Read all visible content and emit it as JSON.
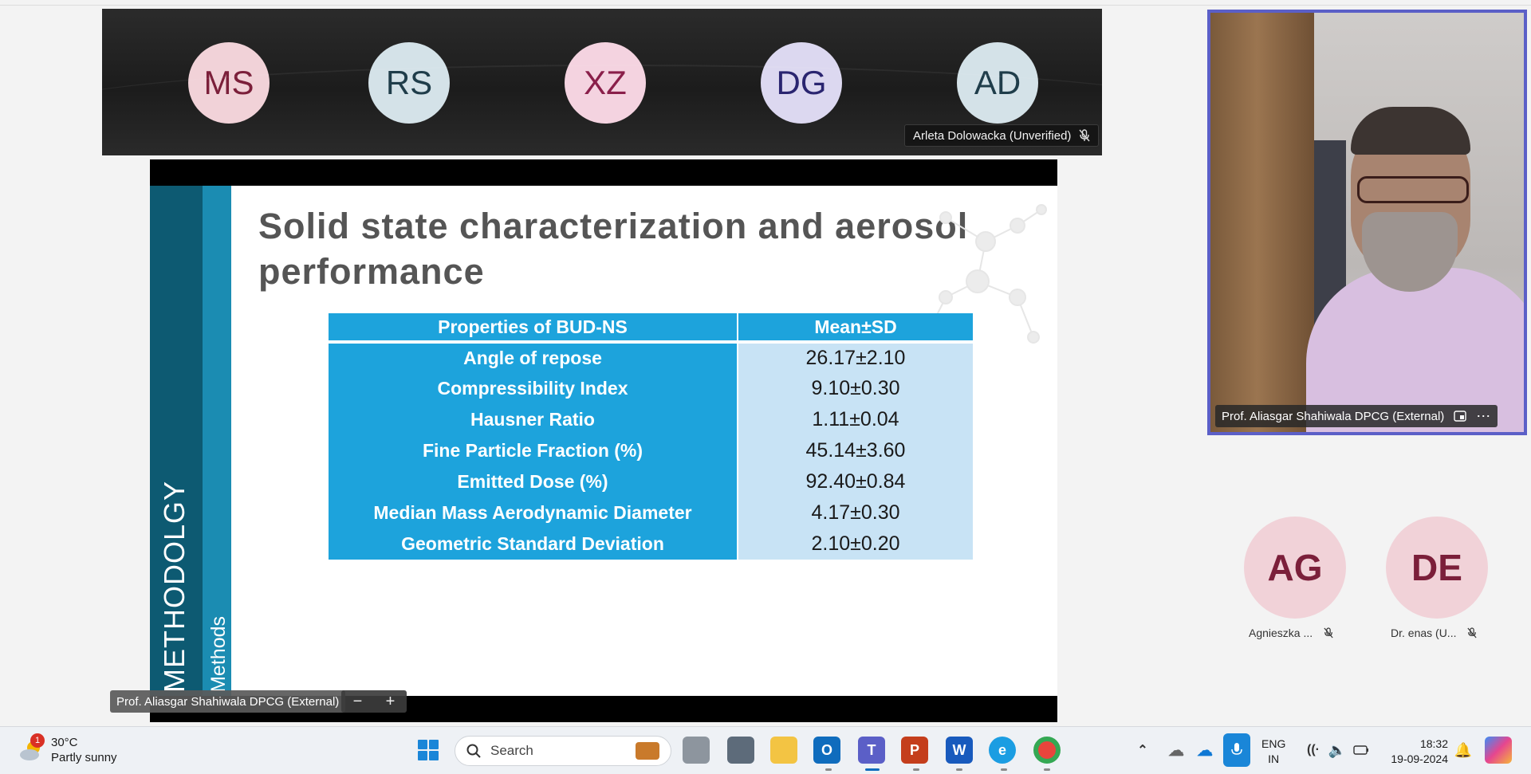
{
  "strip": {
    "participants": [
      {
        "initials": "MS",
        "bg": "#f1d2d8",
        "fg": "#7b1f3a"
      },
      {
        "initials": "RS",
        "bg": "#d4e2e8",
        "fg": "#1f3d4a"
      },
      {
        "initials": "XZ",
        "bg": "#f4d3e0",
        "fg": "#8a1f4a"
      },
      {
        "initials": "DG",
        "bg": "#dcd8f0",
        "fg": "#2a2570"
      },
      {
        "initials": "AD",
        "bg": "#d4e2e8",
        "fg": "#1f3d4a"
      }
    ],
    "active_name": "Arleta Dolowacka (Unverified)"
  },
  "slide": {
    "title": "Solid state characterization and aerosol performance",
    "side_label_big": "METHODOLGY",
    "side_label_small": "Methods",
    "table": {
      "headers": [
        "Properties of BUD-NS",
        "Mean±SD"
      ],
      "rows": [
        [
          "Angle of repose",
          "26.17±2.10"
        ],
        [
          "Compressibility Index",
          "9.10±0.30"
        ],
        [
          "Hausner Ratio",
          "1.11±0.04"
        ],
        [
          "Fine Particle Fraction (%)",
          "45.14±3.60"
        ],
        [
          "Emitted Dose (%)",
          "92.40±0.84"
        ],
        [
          "Median Mass Aerodynamic Diameter",
          "4.17±0.30"
        ],
        [
          "Geometric Standard Deviation",
          "2.10±0.20"
        ]
      ]
    },
    "presenter_tag": "Prof. Aliasgar Shahiwala DPCG (External)",
    "zoom_minus": "−",
    "zoom_plus": "+"
  },
  "video": {
    "name": "Prof. Aliasgar Shahiwala DPCG (External)",
    "border_color": "#5b5fc7"
  },
  "side_participants": [
    {
      "initials": "AG",
      "label": "Agnieszka ..."
    },
    {
      "initials": "DE",
      "label": "Dr. enas (U..."
    }
  ],
  "taskbar": {
    "weather_temp": "30°C",
    "weather_desc": "Partly sunny",
    "weather_badge": "1",
    "search_placeholder": "Search",
    "lang_top": "ENG",
    "lang_bottom": "IN",
    "time": "18:32",
    "date": "19-09-2024"
  }
}
